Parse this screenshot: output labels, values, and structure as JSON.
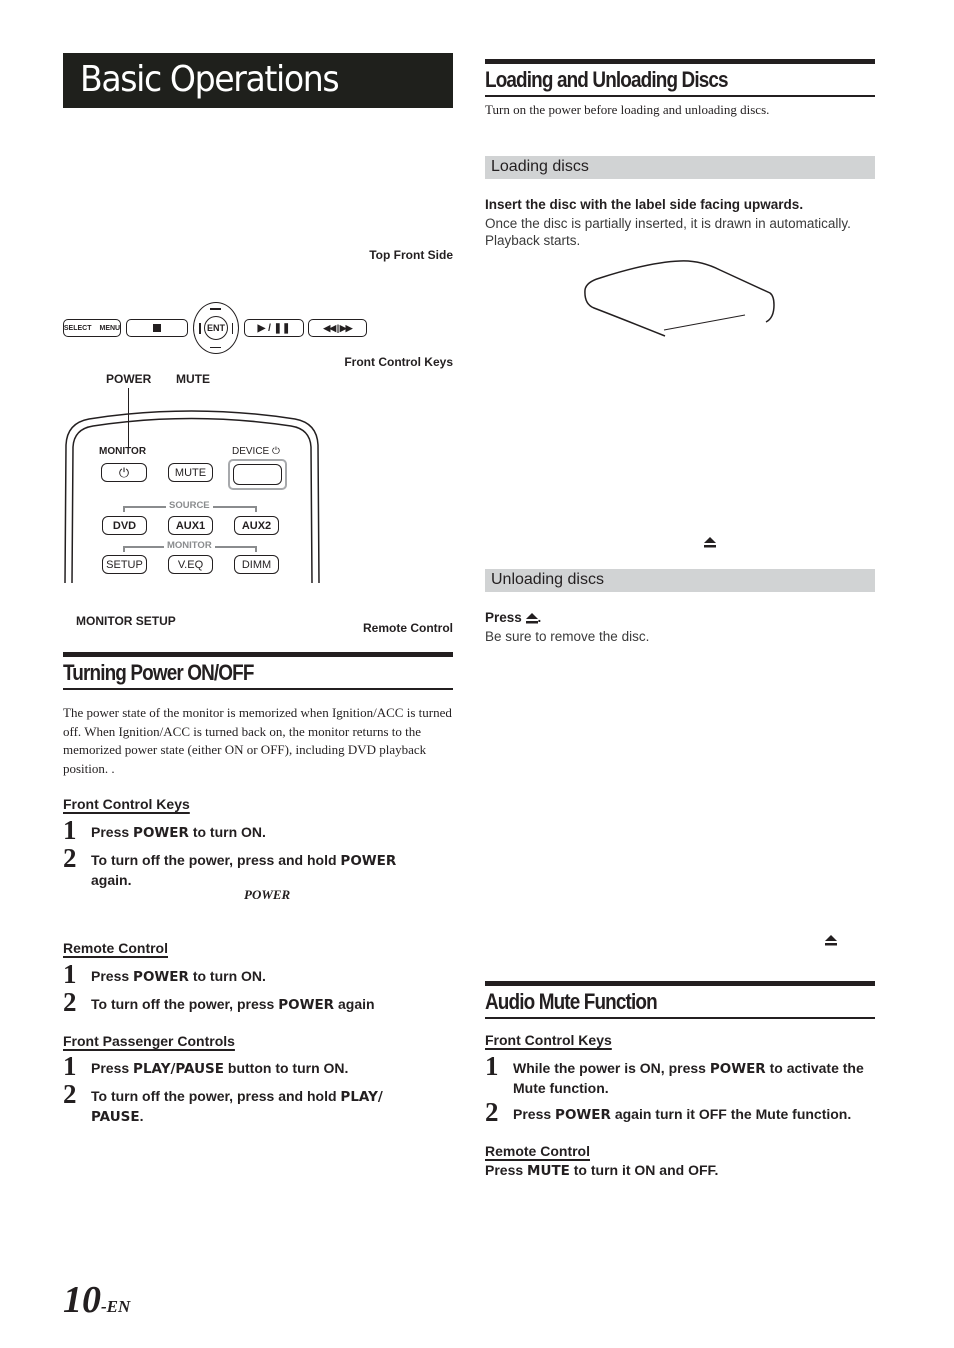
{
  "page": {
    "title": "Basic Operations",
    "page_number": "10",
    "page_suffix": "-EN"
  },
  "left": {
    "captions": {
      "top_front_side": "Top Front Side",
      "front_control_keys": "Front Control Keys",
      "power": "POWER",
      "mute": "MUTE",
      "monitor_setup": "MONITOR SETUP",
      "remote_control": "Remote Control"
    },
    "front_keys": {
      "select": "SELECT",
      "menu": "MENU",
      "stop_icon": "stop-icon",
      "enter": "ENT",
      "play_pause": "▶ / ❚❚",
      "prev_next": "◀◀ | ▶▶"
    },
    "remote": {
      "monitor_label": "MONITOR",
      "device_label": "DEVICE",
      "power_glyph": "⏻",
      "mute": "MUTE",
      "source_group": "SOURCE",
      "monitor_group": "MONITOR",
      "dvd": "DVD",
      "aux1": "AUX1",
      "aux2": "AUX2",
      "setup": "SETUP",
      "veq": "V.EQ",
      "dimm": "DIMM",
      "device_highlight_color": "#a7a9ac"
    },
    "power_section": {
      "heading": "Turning Power ON/OFF",
      "intro": "The power state of the monitor is memorized when Ignition/ACC is turned off.  When Ignition/ACC is turned back on, the monitor returns to the memorized power state (either ON or OFF), including DVD playback position. .",
      "groups": [
        {
          "label": "Front Control Keys",
          "steps": [
            {
              "num": "1",
              "pre": "Press ",
              "bold": "POWER",
              "post": " to turn ON."
            },
            {
              "num": "2",
              "pre": "To turn off the power, press and hold ",
              "bold": "POWER",
              "post": " again."
            }
          ],
          "note": "POWER"
        },
        {
          "label": "Remote Control",
          "steps": [
            {
              "num": "1",
              "pre": "Press ",
              "bold": "POWER",
              "post": " to turn ON."
            },
            {
              "num": "2",
              "pre": "To turn off the power, press ",
              "bold": "POWER",
              "post": " again"
            }
          ]
        },
        {
          "label": "Front Passenger Controls",
          "steps": [
            {
              "num": "1",
              "pre": "Press ",
              "bold": "PLAY/PAUSE",
              "post": " button to turn ON."
            },
            {
              "num": "2",
              "pre": "To turn off the power, press and hold ",
              "bold": "PLAY/ PAUSE",
              "post": "."
            }
          ]
        }
      ]
    }
  },
  "right": {
    "discs_section": {
      "heading": "Loading and Unloading Discs",
      "intro": "Turn on the power before loading and unloading discs.",
      "loading": {
        "subheading": "Loading discs",
        "instruction": "Insert the disc with the label side facing upwards.",
        "detail": "Once the disc is partially inserted, it is drawn in automatically. Playback starts."
      },
      "unloading": {
        "subheading": "Unloading discs",
        "instruction_pre": "Press ",
        "instruction_post": ".",
        "detail": "Be sure to remove the disc."
      },
      "eject_icon": "eject-icon"
    },
    "mute_section": {
      "heading": "Audio Mute Function",
      "groups": [
        {
          "label": "Front Control Keys",
          "steps": [
            {
              "num": "1",
              "pre": "While the power is ON, press ",
              "bold": "POWER",
              "post": " to activate the Mute function."
            },
            {
              "num": "2",
              "pre": "Press ",
              "bold": "POWER",
              "post": " again turn it OFF the Mute function."
            }
          ]
        },
        {
          "label": "Remote Control",
          "line": {
            "pre": "Press ",
            "bold": "MUTE",
            "post": " to turn it ON and OFF."
          }
        }
      ]
    },
    "sub_bar_color": "#d1d3d4"
  }
}
